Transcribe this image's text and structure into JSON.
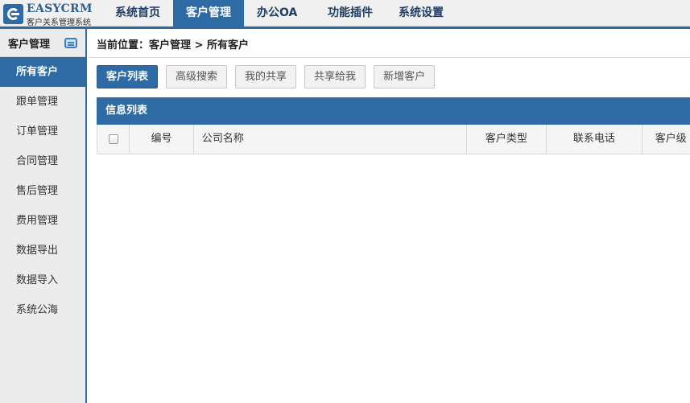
{
  "logo": {
    "title": "EASYCRM",
    "subtitle": "客户关系管理系统"
  },
  "nav": {
    "items": [
      {
        "label": "系统首页"
      },
      {
        "label": "客户管理"
      },
      {
        "label": "办公OA"
      },
      {
        "label": "功能插件"
      },
      {
        "label": "系统设置"
      }
    ],
    "active": "客户管理"
  },
  "sidebar": {
    "title": "客户管理",
    "items": [
      {
        "label": "所有客户"
      },
      {
        "label": "跟单管理"
      },
      {
        "label": "订单管理"
      },
      {
        "label": "合同管理"
      },
      {
        "label": "售后管理"
      },
      {
        "label": "费用管理"
      },
      {
        "label": "数据导出"
      },
      {
        "label": "数据导入"
      },
      {
        "label": "系统公海"
      }
    ],
    "active": "所有客户"
  },
  "breadcrumb": "当前位置：客户管理 > 所有客户",
  "toolbar": {
    "buttons": [
      {
        "label": "客户列表"
      },
      {
        "label": "高级搜索"
      },
      {
        "label": "我的共享"
      },
      {
        "label": "共享给我"
      },
      {
        "label": "新增客户"
      }
    ]
  },
  "panel": {
    "title": "信息列表",
    "columns": [
      "编号",
      "公司名称",
      "客户类型",
      "联系电话",
      "客户级"
    ]
  },
  "colors": {
    "accent": "#2e6aa3",
    "sidebar_bg": "#ececec",
    "topbar_bg": "#f0f0f0"
  },
  "icons": {
    "logo": "easycrm-logo-icon",
    "sidebar_head": "card-icon",
    "select_all": "checkbox-icon"
  }
}
